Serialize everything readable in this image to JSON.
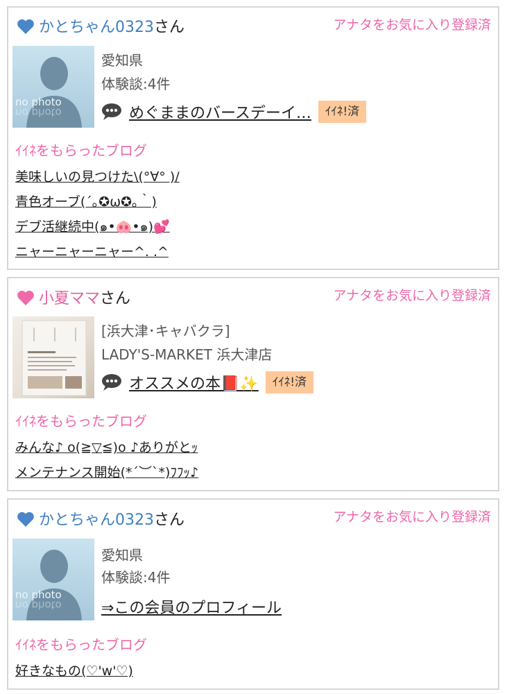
{
  "cards": [
    {
      "user_name": "かとちゃん0323",
      "honorific": "さん",
      "name_color": "#3f7fbf",
      "heart_color": "#4a86c8",
      "fav_status": "アナタをお気に入り登録済",
      "avatar_text": "no photo",
      "info": [
        "愛知県",
        "体験談:4件"
      ],
      "latest_blog": "めぐままのバースデーイ…",
      "iine_badge": "ｲｲﾈ!済",
      "section_title": "ｲｲﾈをもらったブログ",
      "liked_blogs": [
        "美味しいの見つけた\\(°∀° )/",
        "青色オーブ(´｡✪ω✪｡｀)",
        "デブ活継続中(๑•🐽•๑)💕",
        "ニャーニャーニャー^. .^"
      ]
    },
    {
      "user_name": "小夏ママ",
      "honorific": "さん",
      "name_color": "#e0609e",
      "heart_color": "#ef6aa8",
      "fav_status": "アナタをお気に入り登録済",
      "info": [
        "[浜大津･キャバクラ]",
        "LADY'S-MARKET 浜大津店"
      ],
      "latest_blog": "オススメの本📕✨",
      "iine_badge": "ｲｲﾈ!済",
      "section_title": "ｲｲﾈをもらったブログ",
      "liked_blogs": [
        "みんな♪ o(≧▽≦)o ♪ありがとｯ",
        "メンテナンス開始(*´︶`*)ﾌﾌｯ♪"
      ]
    },
    {
      "user_name": "かとちゃん0323",
      "honorific": "さん",
      "name_color": "#3f7fbf",
      "heart_color": "#4a86c8",
      "fav_status": "アナタをお気に入り登録済",
      "avatar_text": "no photo",
      "info": [
        "愛知県",
        "体験談:4件"
      ],
      "profile_link": "⇒この会員のプロフィール",
      "section_title": "ｲｲﾈをもらったブログ",
      "liked_blogs": [
        "好きなもの(♡'w'♡)"
      ]
    }
  ]
}
